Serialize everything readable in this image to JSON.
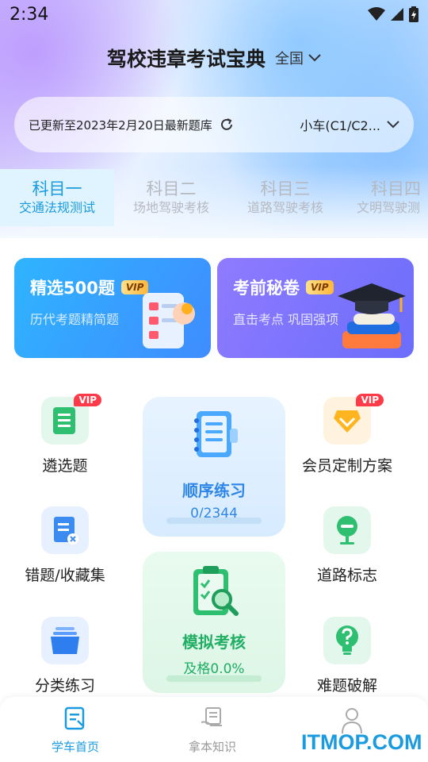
{
  "status_bar": {
    "time": "2:34"
  },
  "header": {
    "title": "驾校违章考试宝典",
    "region": "全国"
  },
  "update_bar": {
    "text": "已更新至2023年2月20日最新题库",
    "car_type": "小车(C1/C2..."
  },
  "subject_tabs": [
    {
      "title": "科目一",
      "subtitle": "交通法规测试",
      "active": true
    },
    {
      "title": "科目二",
      "subtitle": "场地驾驶考核",
      "active": false
    },
    {
      "title": "科目三",
      "subtitle": "道路驾驶考核",
      "active": false
    },
    {
      "title": "科目四",
      "subtitle": "文明驾驶测",
      "active": false
    }
  ],
  "promo_cards": [
    {
      "title": "精选500题",
      "tag": "VIP",
      "subtitle": "历代考题精简题"
    },
    {
      "title": "考前秘卷",
      "tag": "VIP",
      "subtitle": "直击考点 巩固强项"
    }
  ],
  "features": {
    "selected": {
      "label": "遴选题",
      "badge": "VIP"
    },
    "member_plan": {
      "label": "会员定制方案",
      "badge": "VIP"
    },
    "wrong_questions": {
      "label": "错题/收藏集"
    },
    "road_signs": {
      "label": "道路标志"
    },
    "category_practice": {
      "label": "分类练习"
    },
    "hard_questions": {
      "label": "难题破解"
    }
  },
  "sequential_practice": {
    "title": "顺序练习",
    "progress_text": "0/2344",
    "progress": 0.0
  },
  "mock_exam": {
    "title": "模拟考核",
    "pass_rate_text": "及格0.0%",
    "progress": 0.0
  },
  "bottom_nav": [
    {
      "label": "学车首页",
      "active": true
    },
    {
      "label": "拿本知识",
      "active": false
    },
    {
      "label": "",
      "active": false
    }
  ],
  "watermark": "ITMOP.COM",
  "colors": {
    "accent": "#1a9be0",
    "practice_blue": "#2e86e8",
    "exam_green": "#1fae63",
    "vip_red": "#ff3b4a"
  }
}
